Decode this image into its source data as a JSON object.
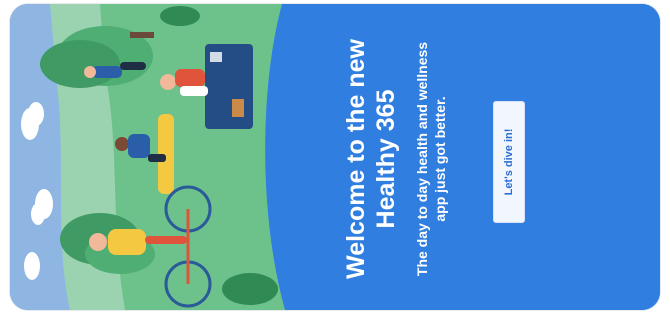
{
  "welcome": {
    "headline": "Welcome to the new Healthy 365",
    "subline": "The day to day health and wellness app just got better.",
    "cta_label": "Let's dive in!"
  },
  "colors": {
    "brand_blue": "#2f7ee0",
    "grass": "#6cc28a",
    "sky": "#8fb6e3"
  },
  "icons": [
    "picnic-illustration"
  ]
}
